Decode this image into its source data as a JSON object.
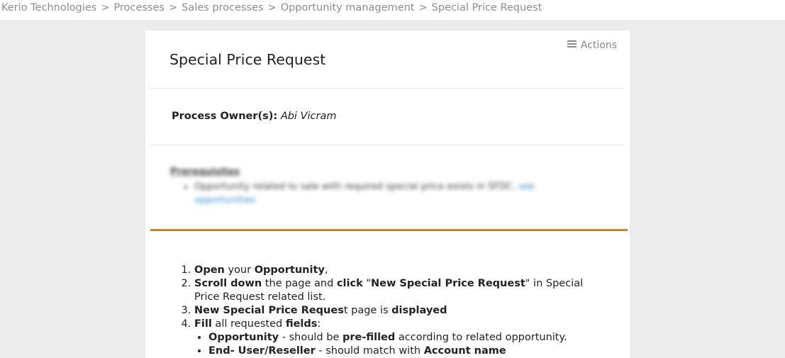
{
  "breadcrumb": {
    "items": [
      "Kerio Technologies",
      "Processes",
      "Sales processes",
      "Opportunity management"
    ],
    "separator": ">",
    "current": "Special Price Request"
  },
  "card": {
    "actions_label": "Actions",
    "title": "Special Price Request",
    "owner_label": "Process Owner(s):",
    "owner_name": "Abi Vicram",
    "prerequisites": {
      "title": "Prerequisites",
      "item_text": "Opportunity related to sale with required special price exists in SFDC.",
      "item_link": "see opportunities"
    },
    "colors": {
      "accent": "#c9860a",
      "link": "#3a8fd8"
    }
  },
  "steps": {
    "s1": {
      "a": "Open",
      "b": " your ",
      "c": "Opportunity",
      "d": ","
    },
    "s2": {
      "a": "Scroll down",
      "b": " the page and ",
      "c": "click",
      "d": " \"",
      "e": "New Special Price Request",
      "f": "\" in Special Price Request related list."
    },
    "s3": {
      "a": "New Special Price Reques",
      "b": "t page is ",
      "c": "displayed"
    },
    "s4": {
      "a": "Fill",
      "b": " all requested ",
      "c": "fields",
      "d": ":"
    },
    "sub1": {
      "a": "Opportunity",
      "b": " - should be ",
      "c": "pre-filled",
      "d": " according to related opportunity."
    },
    "sub2": {
      "a": "End- User/Reseller",
      "b": " - should match with ",
      "c": "Account name"
    }
  }
}
